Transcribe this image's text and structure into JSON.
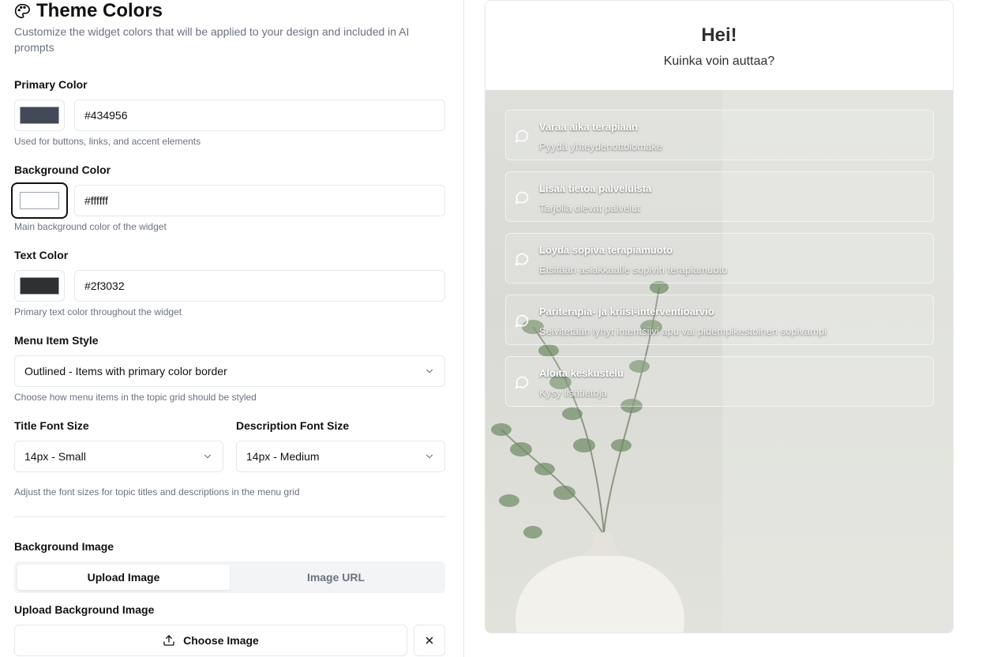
{
  "section": {
    "title": "Theme Colors",
    "subtitle": "Customize the widget colors that will be applied to your design and included in AI prompts"
  },
  "primary_color": {
    "label": "Primary Color",
    "value": "#434956",
    "help": "Used for buttons, links, and accent elements"
  },
  "background_color": {
    "label": "Background Color",
    "value": "#ffffff",
    "help": "Main background color of the widget"
  },
  "text_color": {
    "label": "Text Color",
    "value": "#2f3032",
    "help": "Primary text color throughout the widget"
  },
  "menu_item_style": {
    "label": "Menu Item Style",
    "selected": "Outlined - Items with primary color border",
    "help": "Choose how menu items in the topic grid should be styled"
  },
  "font_sizes": {
    "title_label": "Title Font Size",
    "title_selected": "14px - Small",
    "description_label": "Description Font Size",
    "description_selected": "14px - Medium",
    "help": "Adjust the font sizes for topic titles and descriptions in the menu grid"
  },
  "background_image": {
    "label": "Background Image",
    "tabs": [
      {
        "label": "Upload Image",
        "active": true
      },
      {
        "label": "Image URL",
        "active": false
      }
    ],
    "upload_label": "Upload Background Image",
    "choose_button": "Choose Image",
    "icons": {
      "upload": "upload-icon",
      "clear": "close-icon"
    }
  },
  "preview": {
    "heading": "Hei!",
    "subheading": "Kuinka voin auttaa?",
    "menu_items": [
      {
        "title": "Varaa aika terapiaan",
        "description": "Pyydä yhteydenottolomake"
      },
      {
        "title": "Lisää tietoa palveluista",
        "description": "Tarjolla olevat palvelut"
      },
      {
        "title": "Löydä sopiva terapiamuoto",
        "description": "Etsitään asiakkaalle sopivin terapiamuoto"
      },
      {
        "title": "Pariterapia- ja kriisi-interventioarvio",
        "description": "Selvitetään lyhyt intentsiivi apu vai pidempikestoinen sopivampi"
      },
      {
        "title": "Aloita keskustelu",
        "description": "Kysy lisätietoja"
      }
    ],
    "menu_icon": "chat-bubble-icon"
  }
}
